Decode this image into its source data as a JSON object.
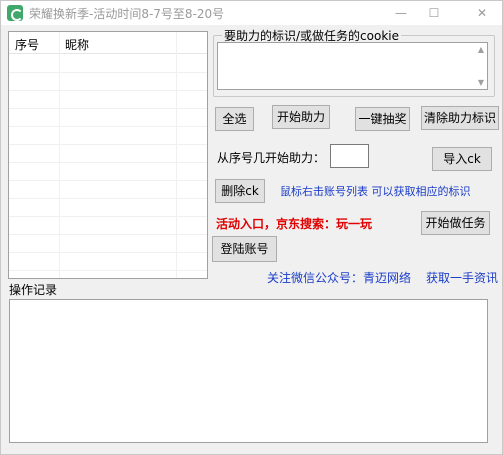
{
  "window": {
    "title": "荣耀换新季-活动时间8-7号至8-20号",
    "minimize": "—",
    "maximize": "☐",
    "close": "✕"
  },
  "list": {
    "columns": [
      "序号",
      "昵称"
    ]
  },
  "cookie": {
    "title": "要助力的标识/或做任务的cookie",
    "value": ""
  },
  "buttons": {
    "select_all": "全选",
    "start_assist": "开始助力",
    "one_click_draw": "一键抽奖",
    "clear_assist": "清除助力标识",
    "import_ck": "导入ck",
    "delete_ck": "删除ck",
    "start_task": "开始做任务",
    "login": "登陆账号"
  },
  "labels": {
    "start_from": "从序号几开始助力：",
    "right_click_hint": "鼠标右击账号列表 可以获取相应的标识",
    "activity_entry": "活动入口，京东搜索：玩一玩",
    "follow_wechat": "关注微信公众号：青迈网络",
    "get_news": "获取一手资讯",
    "log_title": "操作记录"
  },
  "start_index": {
    "value": ""
  },
  "log": {
    "content": ""
  }
}
